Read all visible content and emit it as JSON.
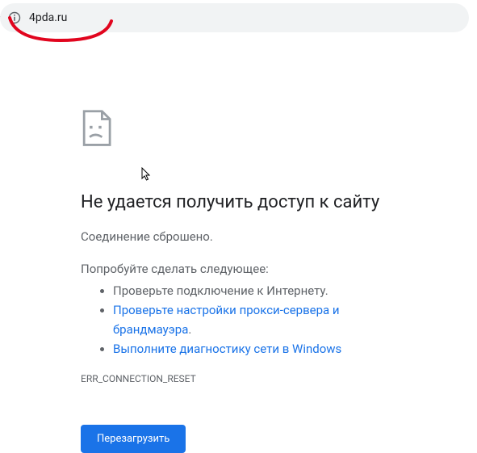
{
  "address_bar": {
    "url": "4pda.ru"
  },
  "error": {
    "title": "Не удается получить доступ к сайту",
    "subtitle": "Соединение сброшено.",
    "suggestion_intro": "Попробуйте сделать следующее:",
    "suggestions": [
      {
        "text": "Проверьте подключение к Интернету.",
        "link": false
      },
      {
        "text": "Проверьте настройки прокси-сервера и брандмауэра",
        "link": true,
        "suffix": "."
      },
      {
        "text": "Выполните диагностику сети в Windows",
        "link": true,
        "suffix": ""
      }
    ],
    "code": "ERR_CONNECTION_RESET",
    "reload_label": "Перезагрузить"
  },
  "colors": {
    "accent": "#1a73e8",
    "text": "#202124",
    "muted": "#5f6368"
  }
}
